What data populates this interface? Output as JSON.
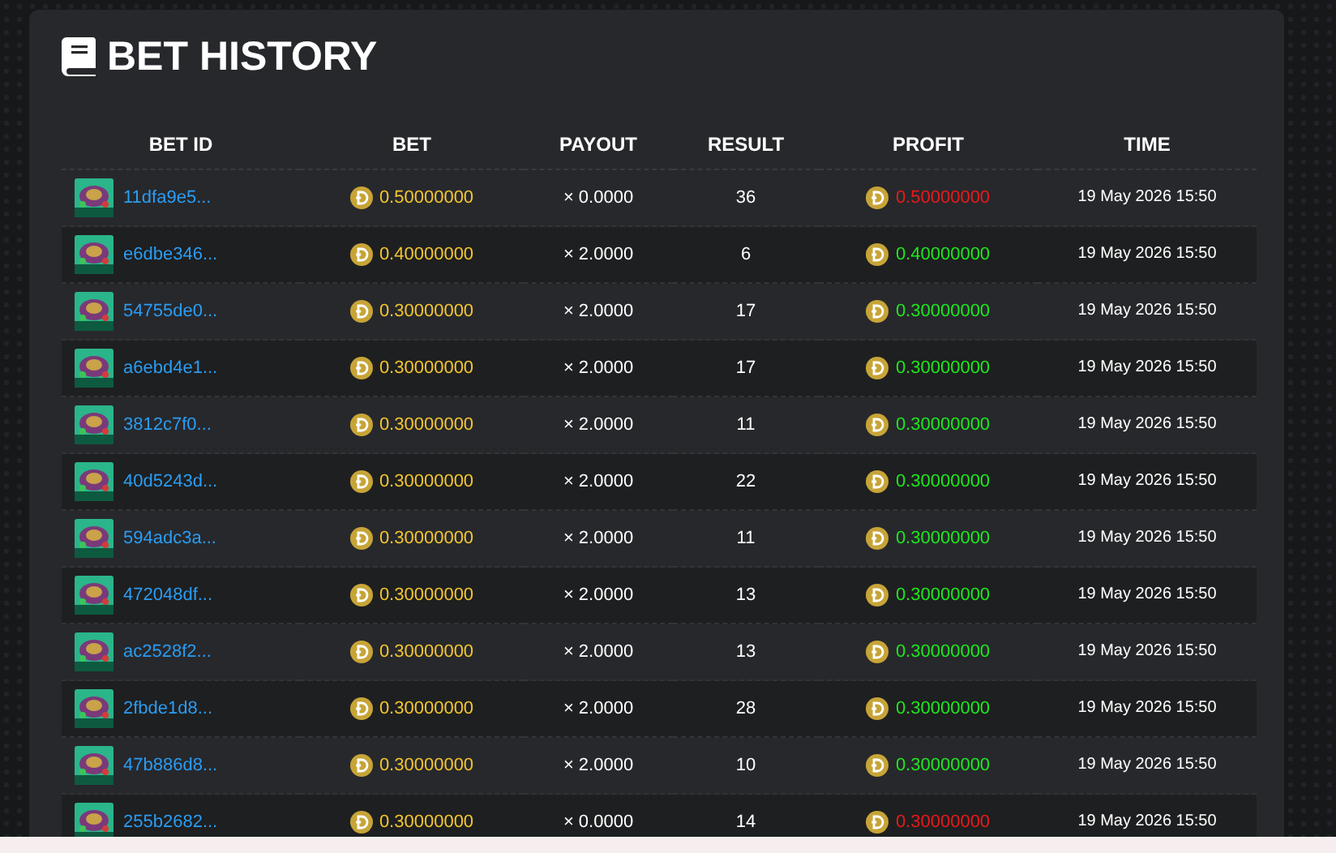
{
  "title": "BET HISTORY",
  "table": {
    "columns": [
      "BET ID",
      "BET",
      "PAYOUT",
      "RESULT",
      "PROFIT",
      "TIME"
    ],
    "rows": [
      {
        "bet_id": "11dfa9e5...",
        "bet": "0.50000000",
        "payout": "× 0.0000",
        "result": "36",
        "profit": "0.50000000",
        "win": false,
        "time": "19 May 2026 15:50"
      },
      {
        "bet_id": "e6dbe346...",
        "bet": "0.40000000",
        "payout": "× 2.0000",
        "result": "6",
        "profit": "0.40000000",
        "win": true,
        "time": "19 May 2026 15:50"
      },
      {
        "bet_id": "54755de0...",
        "bet": "0.30000000",
        "payout": "× 2.0000",
        "result": "17",
        "profit": "0.30000000",
        "win": true,
        "time": "19 May 2026 15:50"
      },
      {
        "bet_id": "a6ebd4e1...",
        "bet": "0.30000000",
        "payout": "× 2.0000",
        "result": "17",
        "profit": "0.30000000",
        "win": true,
        "time": "19 May 2026 15:50"
      },
      {
        "bet_id": "3812c7f0...",
        "bet": "0.30000000",
        "payout": "× 2.0000",
        "result": "11",
        "profit": "0.30000000",
        "win": true,
        "time": "19 May 2026 15:50"
      },
      {
        "bet_id": "40d5243d...",
        "bet": "0.30000000",
        "payout": "× 2.0000",
        "result": "22",
        "profit": "0.30000000",
        "win": true,
        "time": "19 May 2026 15:50"
      },
      {
        "bet_id": "594adc3a...",
        "bet": "0.30000000",
        "payout": "× 2.0000",
        "result": "11",
        "profit": "0.30000000",
        "win": true,
        "time": "19 May 2026 15:50"
      },
      {
        "bet_id": "472048df...",
        "bet": "0.30000000",
        "payout": "× 2.0000",
        "result": "13",
        "profit": "0.30000000",
        "win": true,
        "time": "19 May 2026 15:50"
      },
      {
        "bet_id": "ac2528f2...",
        "bet": "0.30000000",
        "payout": "× 2.0000",
        "result": "13",
        "profit": "0.30000000",
        "win": true,
        "time": "19 May 2026 15:50"
      },
      {
        "bet_id": "2fbde1d8...",
        "bet": "0.30000000",
        "payout": "× 2.0000",
        "result": "28",
        "profit": "0.30000000",
        "win": true,
        "time": "19 May 2026 15:50"
      },
      {
        "bet_id": "47b886d8...",
        "bet": "0.30000000",
        "payout": "× 2.0000",
        "result": "10",
        "profit": "0.30000000",
        "win": true,
        "time": "19 May 2026 15:50"
      },
      {
        "bet_id": "255b2682...",
        "bet": "0.30000000",
        "payout": "× 0.0000",
        "result": "14",
        "profit": "0.30000000",
        "win": false,
        "time": "19 May 2026 15:50"
      }
    ]
  }
}
